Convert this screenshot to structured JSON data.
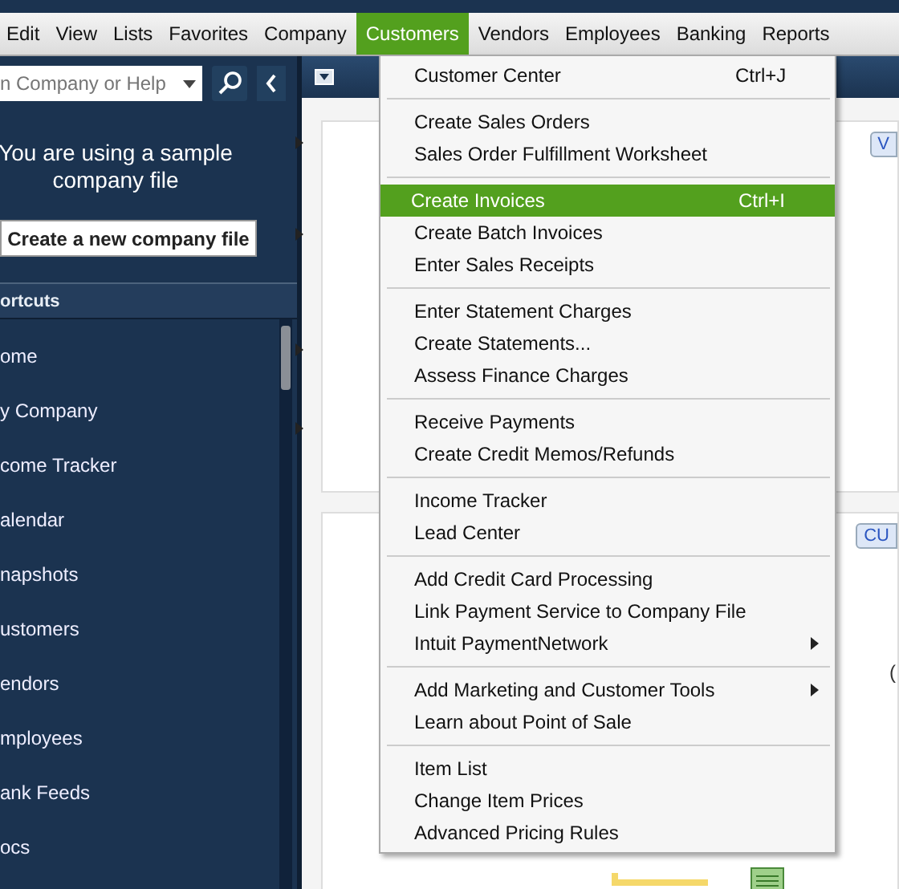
{
  "menu_bar": [
    {
      "label": "Edit",
      "selected": false
    },
    {
      "label": "View",
      "selected": false
    },
    {
      "label": "Lists",
      "selected": false
    },
    {
      "label": "Favorites",
      "selected": false
    },
    {
      "label": "Company",
      "selected": false
    },
    {
      "label": "Customers",
      "selected": true
    },
    {
      "label": "Vendors",
      "selected": false
    },
    {
      "label": "Employees",
      "selected": false
    },
    {
      "label": "Banking",
      "selected": false
    },
    {
      "label": "Reports",
      "selected": false
    }
  ],
  "sidebar": {
    "search": {
      "placeholder": "n Company or Help"
    },
    "notice": "You are using a sample company file",
    "create_button": "Create a new company file",
    "shortcuts_header": "ortcuts",
    "shortcuts": [
      {
        "label": "ome"
      },
      {
        "label": "y Company"
      },
      {
        "label": "come Tracker"
      },
      {
        "label": "alendar"
      },
      {
        "label": "napshots"
      },
      {
        "label": "ustomers"
      },
      {
        "label": "endors"
      },
      {
        "label": "mployees"
      },
      {
        "label": "ank Feeds"
      },
      {
        "label": "ocs"
      }
    ]
  },
  "main": {
    "tab_1": "V",
    "tab_2": "CU",
    "cut_text": "("
  },
  "dropdown": {
    "groups": [
      [
        {
          "label": "Customer Center",
          "shortcut": "Ctrl+J",
          "submenu": false,
          "selected": false
        }
      ],
      [
        {
          "label": "Create Sales Orders",
          "submenu": false,
          "selected": false
        },
        {
          "label": "Sales Order Fulfillment Worksheet",
          "submenu": false,
          "selected": false
        }
      ],
      [
        {
          "label": "Create Invoices",
          "shortcut": "Ctrl+I",
          "submenu": false,
          "selected": true
        },
        {
          "label": "Create Batch Invoices",
          "submenu": false,
          "selected": false
        },
        {
          "label": "Enter Sales Receipts",
          "submenu": false,
          "selected": false
        }
      ],
      [
        {
          "label": "Enter Statement Charges",
          "submenu": false,
          "selected": false
        },
        {
          "label": "Create Statements...",
          "submenu": false,
          "selected": false
        },
        {
          "label": "Assess Finance Charges",
          "submenu": false,
          "selected": false
        }
      ],
      [
        {
          "label": "Receive Payments",
          "submenu": false,
          "selected": false
        },
        {
          "label": "Create Credit Memos/Refunds",
          "submenu": false,
          "selected": false
        }
      ],
      [
        {
          "label": "Income Tracker",
          "submenu": false,
          "selected": false
        },
        {
          "label": "Lead Center",
          "submenu": false,
          "selected": false
        }
      ],
      [
        {
          "label": "Add Credit Card Processing",
          "submenu": false,
          "selected": false
        },
        {
          "label": "Link Payment Service to Company File",
          "submenu": false,
          "selected": false
        },
        {
          "label": "Intuit PaymentNetwork",
          "submenu": true,
          "selected": false
        }
      ],
      [
        {
          "label": "Add Marketing and Customer Tools",
          "submenu": true,
          "selected": false
        },
        {
          "label": "Learn about Point of Sale",
          "submenu": false,
          "selected": false
        }
      ],
      [
        {
          "label": "Item List",
          "submenu": false,
          "selected": false
        },
        {
          "label": "Change Item Prices",
          "submenu": false,
          "selected": false
        },
        {
          "label": "Advanced Pricing Rules",
          "submenu": false,
          "selected": false
        }
      ]
    ]
  }
}
